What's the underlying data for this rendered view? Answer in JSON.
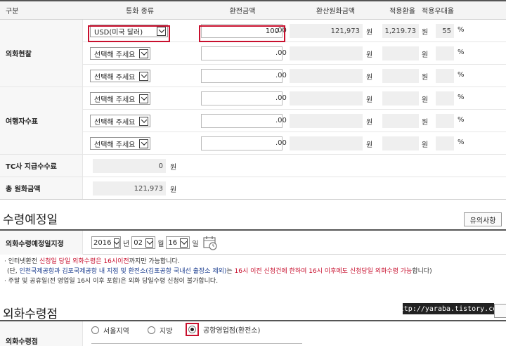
{
  "headers": [
    "구분",
    "통화 종류",
    "환전금액",
    "환산원화금액",
    "적용환율",
    "적용우대율"
  ],
  "sections": {
    "cash": "외화현찰",
    "tc": "여행자수표",
    "tc_fee": "TC사 지급수수료",
    "total": "총 원화금액"
  },
  "cash_rows": [
    {
      "currency": "USD(미국 달러)",
      "amount": "100",
      "decimal": ".00",
      "krw": "121,973",
      "rate": "1,219.73",
      "pref": "55"
    },
    {
      "currency": "선택해 주세요",
      "amount": "",
      "decimal": ".00",
      "krw": "",
      "rate": "",
      "pref": ""
    },
    {
      "currency": "선택해 주세요",
      "amount": "",
      "decimal": ".00",
      "krw": "",
      "rate": "",
      "pref": ""
    }
  ],
  "tc_rows": [
    {
      "currency": "선택해 주세요",
      "amount": "",
      "decimal": ".00",
      "krw": "",
      "rate": "",
      "pref": ""
    },
    {
      "currency": "선택해 주세요",
      "amount": "",
      "decimal": ".00",
      "krw": "",
      "rate": "",
      "pref": ""
    },
    {
      "currency": "선택해 주세요",
      "amount": "",
      "decimal": ".00",
      "krw": "",
      "rate": "",
      "pref": ""
    }
  ],
  "units": {
    "won": "원",
    "percent": "%"
  },
  "tc_fee_value": "0",
  "total_value": "121,973",
  "receive_date": {
    "title": "수령예정일",
    "notice_button": "유의사항",
    "label": "외화수령예정일지정",
    "year": "2016",
    "year_unit": "년",
    "month": "02",
    "month_unit": "월",
    "day": "16",
    "day_unit": "일"
  },
  "notes": {
    "line1_a": "· 인터넷환전 ",
    "line1_b": "신청일 당일 외화수령은 16시이전",
    "line1_c": "까지만 가능합니다.",
    "line2_a": "(단, ",
    "line2_b": "인천국제공항과 김포국제공항 내 지점 및 환전소(김포공항 국내선 출장소 제외)",
    "line2_c": "는 ",
    "line2_d": "16시 이전 신청건에 한하여 16시 이후에도 신청당일 외화수령 가능",
    "line2_e": "합니다)",
    "line3": "· 주말 및 공휴일(전 영업일 16시 이후 포함)은 외화 당일수령 신청이 불가합니다."
  },
  "receive_place": {
    "title": "외화수령점",
    "label": "외화수령점",
    "options": [
      "서울지역",
      "지방",
      "공항영업점(환전소)"
    ],
    "selected": 2
  },
  "watermark": "http://yaraba.tistory.com",
  "colors": {
    "highlight": "#c8102e",
    "header_bg": "#f4f4f4",
    "blue_text": "#1a3c8f"
  }
}
